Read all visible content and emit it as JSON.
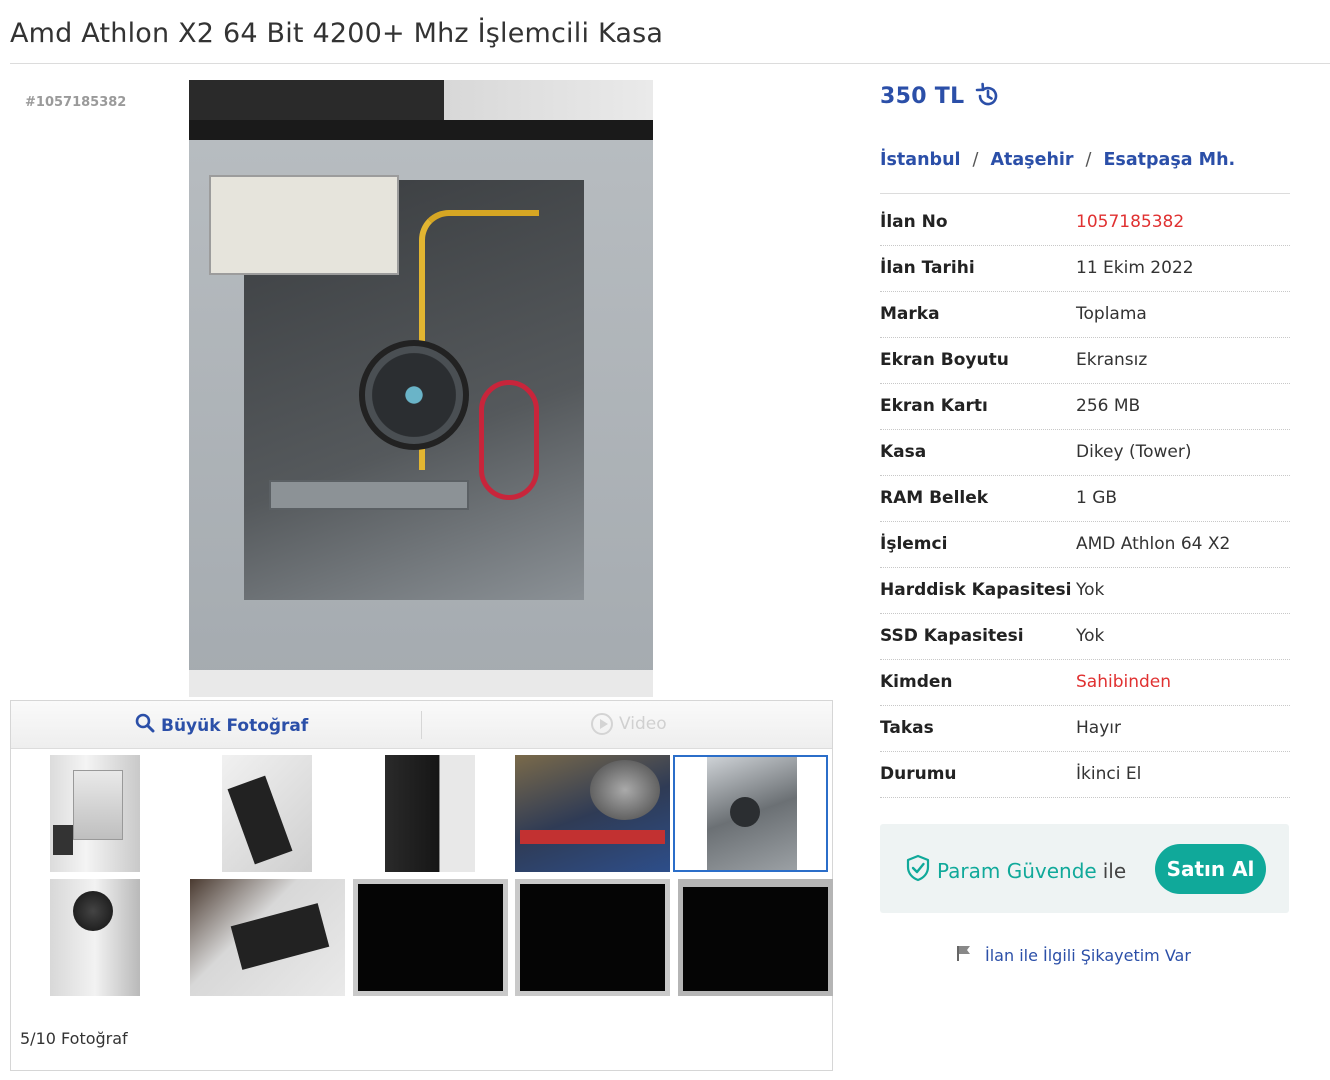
{
  "title": "Amd Athlon X2 64 Bit 4200+ Mhz İşlemcili Kasa",
  "listing_ref": "#1057185382",
  "gallery": {
    "large_photo_label": "Büyük Fotoğraf",
    "video_label": "Video",
    "count_label": "5/10 Fotoğraf"
  },
  "price": "350 TL",
  "location": {
    "city": "İstanbul",
    "district": "Ataşehir",
    "neighborhood": "Esatpaşa Mh.",
    "separator": "/"
  },
  "details": [
    {
      "key": "İlan No",
      "value": "1057185382",
      "highlight": true
    },
    {
      "key": "İlan Tarihi",
      "value": "11 Ekim 2022"
    },
    {
      "key": "Marka",
      "value": "Toplama"
    },
    {
      "key": "Ekran Boyutu",
      "value": "Ekransız"
    },
    {
      "key": "Ekran Kartı",
      "value": "256 MB"
    },
    {
      "key": "Kasa",
      "value": "Dikey (Tower)"
    },
    {
      "key": "RAM Bellek",
      "value": "1 GB"
    },
    {
      "key": "İşlemci",
      "value": "AMD Athlon 64 X2"
    },
    {
      "key": "Harddisk Kapasitesi",
      "value": "Yok"
    },
    {
      "key": "SSD Kapasitesi",
      "value": "Yok"
    },
    {
      "key": "Kimden",
      "value": "Sahibinden",
      "highlight": true
    },
    {
      "key": "Takas",
      "value": "Hayır"
    },
    {
      "key": "Durumu",
      "value": "İkinci El"
    }
  ],
  "safe_payment": {
    "brand": "Param Güvende",
    "suffix": "ile",
    "buy_label": "Satın Al"
  },
  "complaint_label": "İlan ile İlgili Şikayetim Var",
  "colors": {
    "link_blue": "#2b4fa8",
    "highlight_red": "#e03131",
    "teal": "#10a99a"
  }
}
